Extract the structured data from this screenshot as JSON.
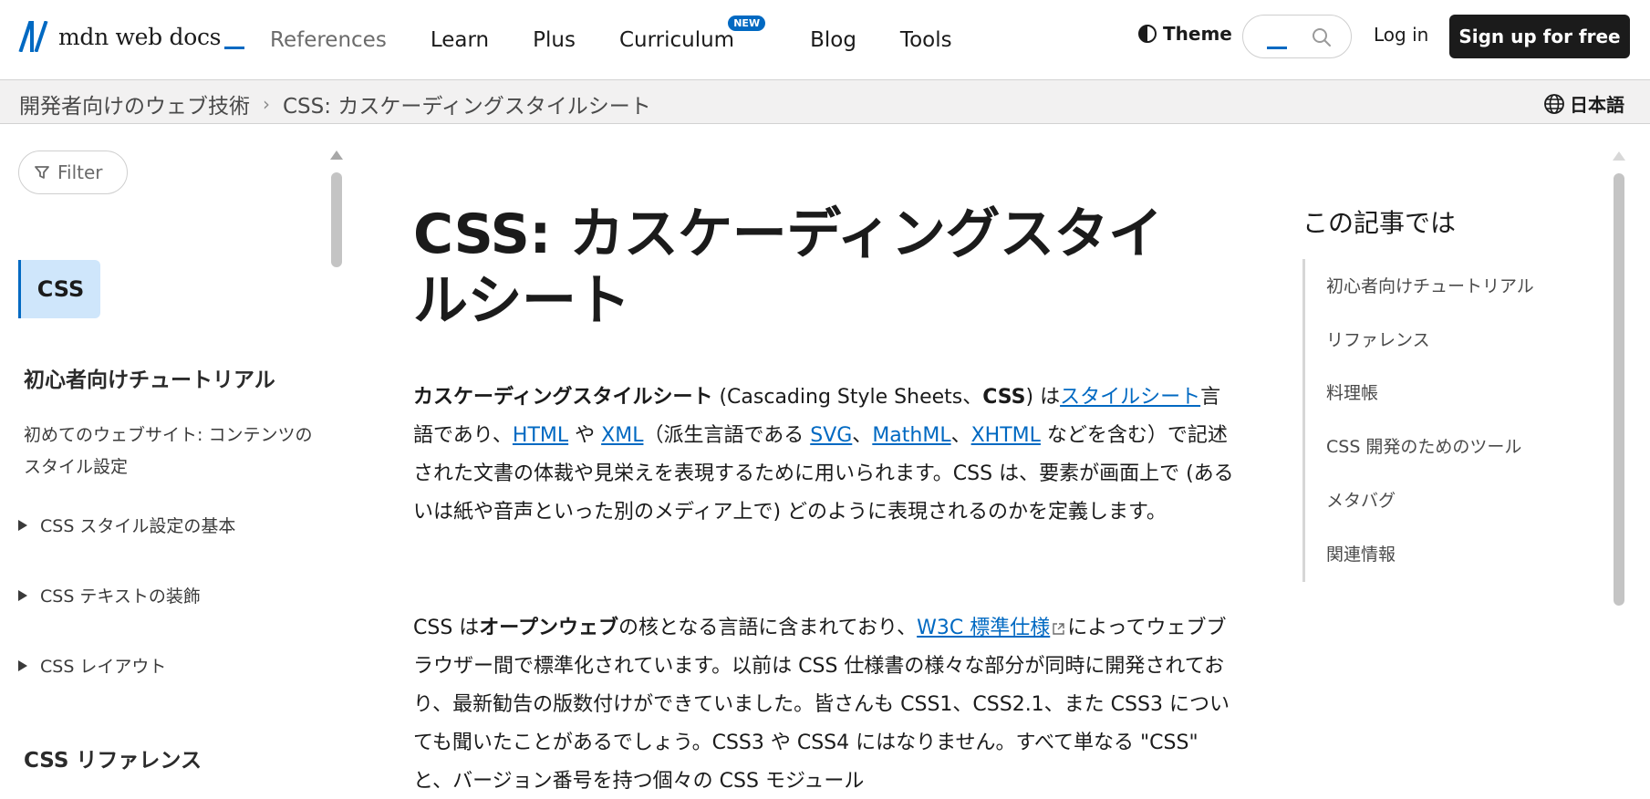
{
  "header": {
    "logo_text": "mdn web docs",
    "nav": [
      {
        "label": "References"
      },
      {
        "label": "Learn"
      },
      {
        "label": "Plus"
      },
      {
        "label": "Curriculum",
        "badge": "NEW"
      },
      {
        "label": "Blog"
      },
      {
        "label": "Tools"
      }
    ],
    "theme_label": "Theme",
    "login_label": "Log in",
    "signup_label": "Sign up for free",
    "accent_color": "#0069c2"
  },
  "breadcrumb": {
    "items": [
      "開発者向けのウェブ技術",
      "CSS: カスケーディングスタイルシート"
    ],
    "language": "日本語"
  },
  "sidebar": {
    "filter_label": "Filter",
    "current": "CSS",
    "section_1": "初心者向けチュートリアル",
    "link_1": "初めてのウェブサイト: コンテンツのスタイル設定",
    "toggles": [
      "CSS スタイル設定の基本",
      "CSS テキストの装飾",
      "CSS レイアウト"
    ],
    "section_2": "CSS リファレンス"
  },
  "main": {
    "title": "CSS: カスケーディングスタイルシート",
    "p1": {
      "t1_bold": "カスケーディングスタイルシート",
      "t2": " (Cascading Style Sheets、",
      "t3_bold": "CSS",
      "t4": ") は",
      "link_stylesheet": "スタイルシート",
      "t5": "言語であり、",
      "link_html": "HTML",
      "t6": " や ",
      "link_xml": "XML",
      "t7": "（派生言語である ",
      "link_svg": "SVG",
      "t8": "、",
      "link_mathml": "MathML",
      "t9": "、",
      "link_xhtml": "XHTML",
      "t10": " などを含む）で記述された文書の体裁や見栄えを表現するために用いられます。CSS は、要素が画面上で (あるいは紙や音声といった別のメディア上で) どのように表現されるのかを定義します。"
    },
    "p2": {
      "t1": "CSS は",
      "t2_bold": "オープンウェブ",
      "t3": "の核となる言語に含まれており、",
      "link_w3c": "W3C 標準仕様",
      "t4": "によってウェブブラウザー間で標準化されています。以前は CSS 仕様書の様々な部分が同時に開発されており、最新勧告の版数付けができていました。皆さんも CSS1、CSS2.1、また CSS3 についても聞いたことがあるでしょう。CSS3 や CSS4 にはなりません。すべて単なる \"CSS\" と、バージョン番号を持つ個々の CSS モジュール"
    }
  },
  "toc": {
    "title": "この記事では",
    "items": [
      "初心者向けチュートリアル",
      "リファレンス",
      "料理帳",
      "CSS 開発のためのツール",
      "メタバグ",
      "関連情報"
    ]
  }
}
